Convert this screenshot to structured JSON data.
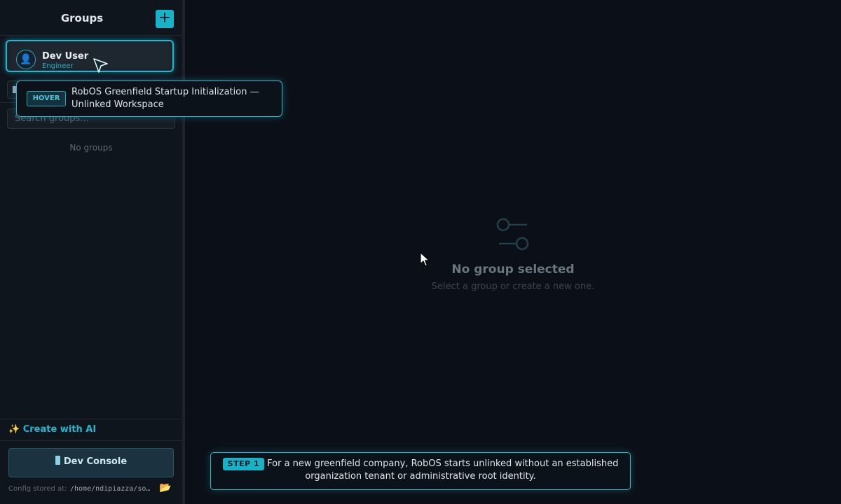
{
  "sidebar": {
    "title": "Groups",
    "add_button": "+",
    "user": {
      "name": "Dev User",
      "role": "Engineer",
      "icon": "user-icon"
    },
    "search_placeholder": "Search groups...",
    "empty_text": "No groups",
    "create_ai": "✨ Create with AI",
    "dev_console": "Dev Console",
    "config_label": "Config stored at:",
    "config_path": "/home/ndipiazza/so…",
    "folder_icon": "📂"
  },
  "main": {
    "empty_title": "No group selected",
    "empty_subtitle": "Select a group or create a new one.",
    "empty_icon": "sliders-icon"
  },
  "tooltip": {
    "badge": "HOVER",
    "text": "RobOS Greenfield Startup Initialization — Unlinked Workspace"
  },
  "step": {
    "badge": "STEP 1",
    "text": "For a new greenfield company, RobOS starts unlinked without an established organization tenant or administrative root identity."
  },
  "colors": {
    "accent": "#17b2c8",
    "background": "#0b1018",
    "sidebar": "#0f151d"
  }
}
